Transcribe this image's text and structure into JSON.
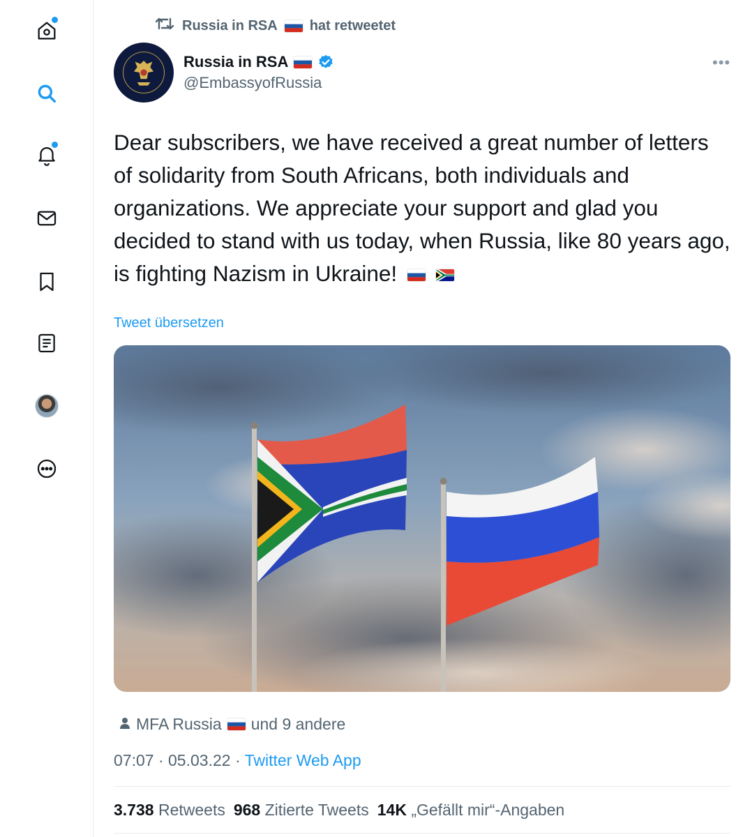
{
  "retweet_header": {
    "text": "Russia in RSA",
    "suffix": "hat retweetet"
  },
  "author": {
    "name": "Russia in RSA",
    "handle": "@EmbassyofRussia"
  },
  "tweet": {
    "text": "Dear subscribers, we have received a great number of letters of solidarity from South Africans, both individuals and organizations. We appreciate your support and glad you decided to stand with us today, when Russia, like 80 years ago, is fighting Nazism in Ukraine!",
    "translate_label": "Tweet übersetzen"
  },
  "likers": {
    "name": "MFA Russia",
    "suffix": "und 9 andere"
  },
  "meta": {
    "time": "07:07",
    "separator": "·",
    "date": "05.03.22",
    "client": "Twitter Web App"
  },
  "stats": {
    "retweets": {
      "count": "3.738",
      "label": "Retweets"
    },
    "quotes": {
      "count": "968",
      "label": "Zitierte Tweets"
    },
    "likes": {
      "count": "14K",
      "label": "„Gefällt mir“-Angaben"
    }
  },
  "icons": {
    "sidebar": [
      "home-icon",
      "search-icon",
      "notifications-icon",
      "messages-icon",
      "bookmarks-icon",
      "lists-icon",
      "profile-avatar",
      "more-icon"
    ],
    "accent": "#1d9bf0",
    "muted": "#536471"
  }
}
